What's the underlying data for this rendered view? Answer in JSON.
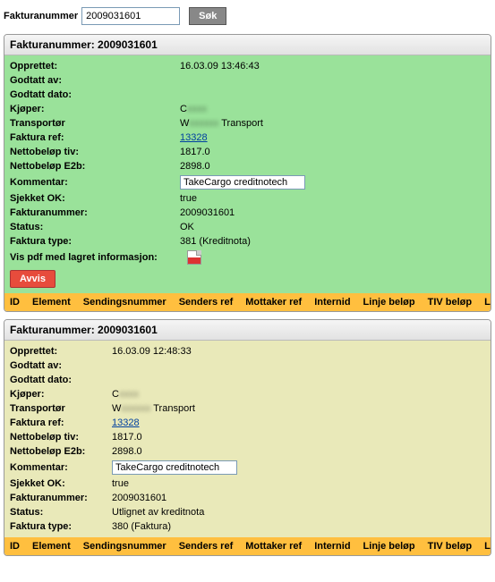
{
  "search": {
    "label": "Fakturanummer",
    "value": "2009031601",
    "button": "Søk"
  },
  "panels": [
    {
      "header_prefix": "Fakturanummer:",
      "header_value": "2009031601",
      "body_class": "green",
      "tight": false,
      "rows": [
        {
          "label": "Opprettet:",
          "value": "16.03.09 13:46:43"
        },
        {
          "label": "Godtatt av:",
          "value": ""
        },
        {
          "label": "Godtatt dato:",
          "value": ""
        },
        {
          "label": "Kjøper:",
          "value": "C",
          "blur_suffix": "xxxx"
        },
        {
          "label": "Transportør",
          "value": "W",
          "blur_suffix": "xxxxxx",
          "suffix": " Transport"
        },
        {
          "label": "Faktura ref:",
          "value": "13328",
          "link": true
        },
        {
          "label": "Nettobeløp tiv:",
          "value": "1817.0"
        },
        {
          "label": "Nettobeløp E2b:",
          "value": "2898.0"
        },
        {
          "label": "Kommentar:",
          "value": "TakeCargo creditnotech",
          "input": true
        },
        {
          "label": "Sjekket OK:",
          "value": "true"
        },
        {
          "label": "Fakturanummer:",
          "value": "2009031601"
        },
        {
          "label": "Status:",
          "value": "OK"
        },
        {
          "label": "Faktura type:",
          "value": "381 (Kreditnota)"
        }
      ],
      "extra_label": "Vis pdf med lagret informasjon:",
      "show_pdf": true,
      "show_avvis": true,
      "avvis_label": "Avvis"
    },
    {
      "header_prefix": "Fakturanummer:",
      "header_value": "2009031601",
      "body_class": "yellow",
      "tight": true,
      "rows": [
        {
          "label": "Opprettet:",
          "value": "16.03.09 12:48:33"
        },
        {
          "label": "Godtatt av:",
          "value": ""
        },
        {
          "label": "Godtatt dato:",
          "value": ""
        },
        {
          "label": "Kjøper:",
          "value": "C",
          "blur_suffix": "xxxx"
        },
        {
          "label": "Transportør",
          "value": "W",
          "blur_suffix": "xxxxxx",
          "suffix": " Transport"
        },
        {
          "label": "Faktura ref:",
          "value": "13328",
          "link": true
        },
        {
          "label": "Nettobeløp tiv:",
          "value": "1817.0"
        },
        {
          "label": "Nettobeløp E2b:",
          "value": "2898.0"
        },
        {
          "label": "Kommentar:",
          "value": "TakeCargo creditnotech",
          "input": true
        },
        {
          "label": "Sjekket OK:",
          "value": "true"
        },
        {
          "label": "Fakturanummer:",
          "value": "2009031601"
        },
        {
          "label": "Status:",
          "value": "Utlignet av kreditnota"
        },
        {
          "label": "Faktura type:",
          "value": "380 (Faktura)"
        }
      ],
      "show_pdf": false,
      "show_avvis": false
    }
  ],
  "columns": [
    "ID",
    "Element",
    "Sendingsnummer",
    "Senders ref",
    "Mottaker ref",
    "Internid",
    "Linje beløp",
    "TIV beløp",
    "Linje feil"
  ]
}
